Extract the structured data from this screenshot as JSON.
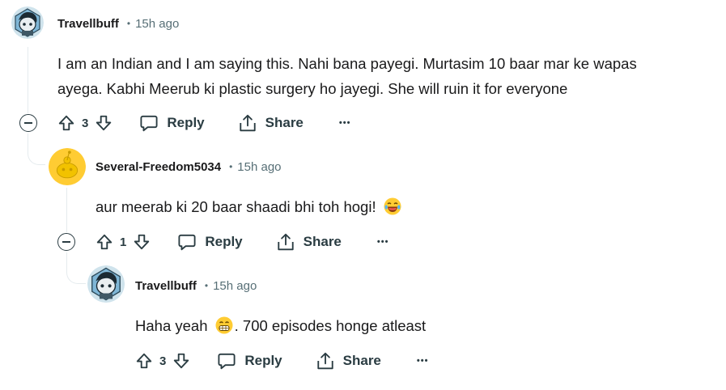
{
  "comments": [
    {
      "author": "Travellbuff",
      "separator": "•",
      "time": "15h ago",
      "body_lines": [
        "I am an Indian and I am saying this. Nahi bana payegi. Murtasim 10 baar mar ke wapas",
        "ayega. Kabhi Meerub ki plastic surgery ho jayegi. She will ruin it for everyone"
      ],
      "votes": "3",
      "reply_label": "Reply",
      "share_label": "Share",
      "more_label": "•••"
    },
    {
      "author": "Several-Freedom5034",
      "separator": "•",
      "time": "15h ago",
      "body_text": "aur meerab ki 20 baar shaadi bhi toh hogi!",
      "emoji": "laughing-tears-emoji",
      "votes": "1",
      "reply_label": "Reply",
      "share_label": "Share",
      "more_label": "•••"
    },
    {
      "author": "Travellbuff",
      "separator": "•",
      "time": "15h ago",
      "body_before": "Haha yeah",
      "emoji": "grinning-emoji",
      "body_after": ". 700 episodes honge atleast",
      "votes": "3",
      "reply_label": "Reply",
      "share_label": "Share",
      "more_label": "•••"
    }
  ],
  "colors": {
    "text": "#1a1a1b",
    "meta": "#576f76",
    "icon": "#2a3c42",
    "thread_line": "#e5ebee",
    "snoo_yellow": "#ffcc33"
  }
}
